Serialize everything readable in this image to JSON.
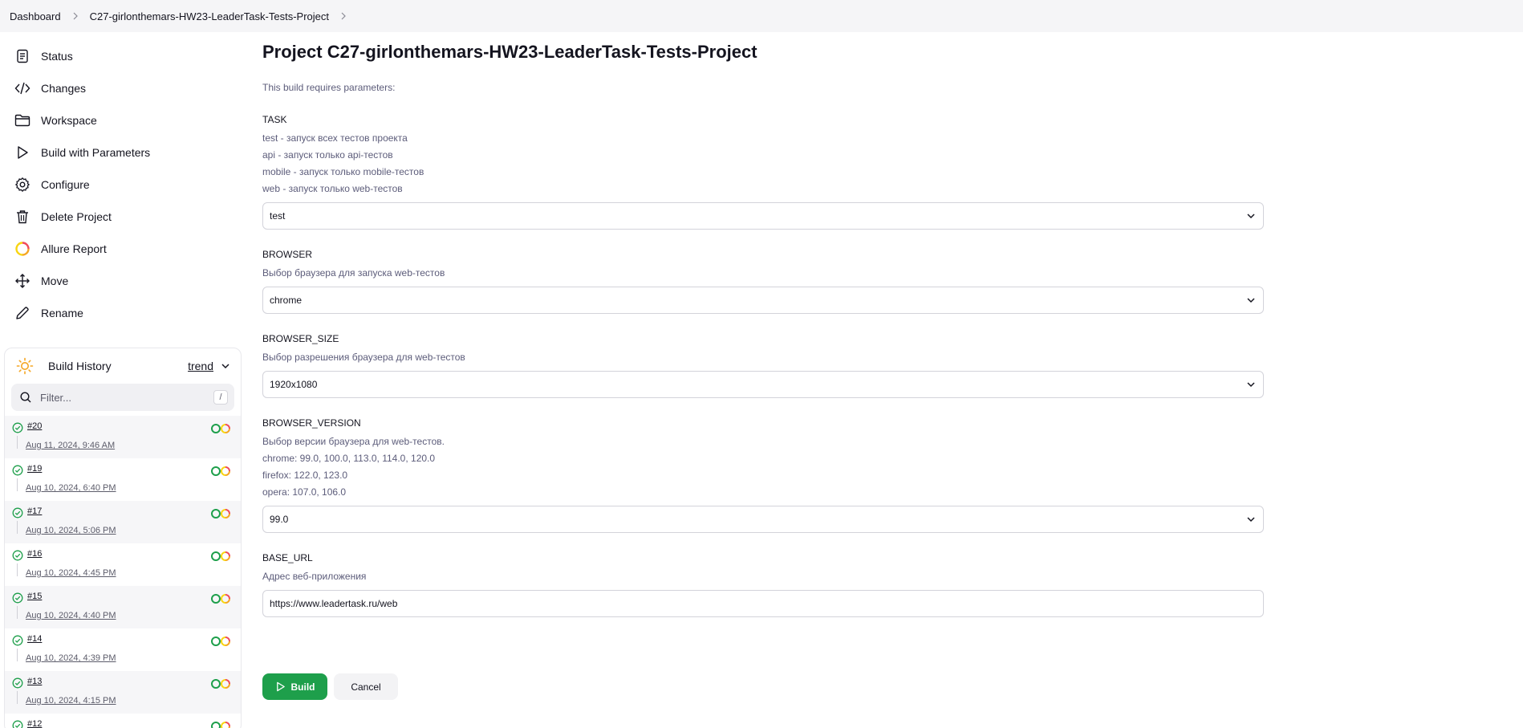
{
  "breadcrumb": {
    "items": [
      "Dashboard",
      "C27-girlonthemars-HW23-LeaderTask-Tests-Project"
    ]
  },
  "sidebar": {
    "items": [
      {
        "label": "Status",
        "icon": "document-icon"
      },
      {
        "label": "Changes",
        "icon": "code-icon"
      },
      {
        "label": "Workspace",
        "icon": "folder-icon"
      },
      {
        "label": "Build with Parameters",
        "icon": "play-icon"
      },
      {
        "label": "Configure",
        "icon": "gear-icon"
      },
      {
        "label": "Delete Project",
        "icon": "trash-icon"
      },
      {
        "label": "Allure Report",
        "icon": "allure-icon"
      },
      {
        "label": "Move",
        "icon": "move-icon"
      },
      {
        "label": "Rename",
        "icon": "pencil-icon"
      }
    ]
  },
  "build_history": {
    "title": "Build History",
    "trend_label": "trend",
    "filter_placeholder": "Filter...",
    "filter_shortcut": "/",
    "builds": [
      {
        "number": "#20",
        "date": "Aug 11, 2024, 9:46 AM"
      },
      {
        "number": "#19",
        "date": "Aug 10, 2024, 6:40 PM"
      },
      {
        "number": "#17",
        "date": "Aug 10, 2024, 5:06 PM"
      },
      {
        "number": "#16",
        "date": "Aug 10, 2024, 4:45 PM"
      },
      {
        "number": "#15",
        "date": "Aug 10, 2024, 4:40 PM"
      },
      {
        "number": "#14",
        "date": "Aug 10, 2024, 4:39 PM"
      },
      {
        "number": "#13",
        "date": "Aug 10, 2024, 4:15 PM"
      },
      {
        "number": "#12",
        "date": ""
      }
    ]
  },
  "main": {
    "title": "Project C27-girlonthemars-HW23-LeaderTask-Tests-Project",
    "requires_text": "This build requires parameters:",
    "params": {
      "task": {
        "name": "TASK",
        "desc": [
          "test - запуск всех тестов проекта",
          "api - запуск только api-тестов",
          "mobile - запуск только mobile-тестов",
          "web - запуск только web-тестов"
        ],
        "value": "test"
      },
      "browser": {
        "name": "BROWSER",
        "desc": [
          "Выбор браузера для запуска web-тестов"
        ],
        "value": "chrome"
      },
      "browser_size": {
        "name": "BROWSER_SIZE",
        "desc": [
          "Выбор разрешения браузера для web-тестов"
        ],
        "value": "1920x1080"
      },
      "browser_version": {
        "name": "BROWSER_VERSION",
        "desc": [
          "Выбор версии браузера для web-тестов.",
          "chrome: 99.0, 100.0, 113.0, 114.0, 120.0",
          "firefox: 122.0, 123.0",
          "opera: 107.0, 106.0"
        ],
        "value": "99.0"
      },
      "base_url": {
        "name": "BASE_URL",
        "desc": [
          "Адрес веб-приложения"
        ],
        "value": "https://www.leadertask.ru/web"
      }
    },
    "build_label": "Build",
    "cancel_label": "Cancel"
  },
  "colors": {
    "build_button": "#1e9f4b",
    "success": "#1e9f4b",
    "text": "#14141f",
    "muted": "#5c5c7a"
  }
}
